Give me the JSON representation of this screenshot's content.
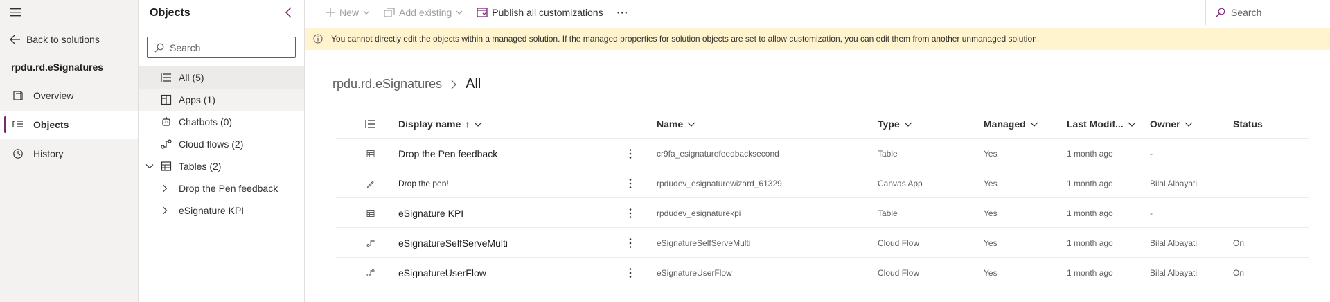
{
  "leftnav": {
    "back_label": "Back to solutions",
    "solution_name": "rpdu.rd.eSignatures",
    "items": [
      {
        "label": "Overview",
        "icon": "overview-icon"
      },
      {
        "label": "Objects",
        "icon": "objects-icon",
        "active": true
      },
      {
        "label": "History",
        "icon": "history-icon"
      }
    ]
  },
  "objects_panel": {
    "title": "Objects",
    "search_placeholder": "Search",
    "tree": [
      {
        "label": "All",
        "count": "(5)"
      },
      {
        "label": "Apps",
        "count": "(1)"
      },
      {
        "label": "Chatbots",
        "count": "(0)"
      },
      {
        "label": "Cloud flows",
        "count": "(2)"
      },
      {
        "label": "Tables",
        "count": "(2)"
      },
      {
        "label": "Drop the Pen feedback"
      },
      {
        "label": "eSignature KPI"
      }
    ]
  },
  "cmdbar": {
    "new_label": "New",
    "add_existing_label": "Add existing",
    "publish_label": "Publish all customizations",
    "more_label": "···",
    "search_label": "Search"
  },
  "warning": {
    "text": "You cannot directly edit the objects within a managed solution. If the managed properties for solution objects are set to allow customization, you can edit them from another unmanaged solution."
  },
  "breadcrumb": {
    "parent": "rpdu.rd.eSignatures",
    "current": "All"
  },
  "grid": {
    "columns": {
      "display_name": "Display name",
      "sort_indicator": "↑",
      "name": "Name",
      "type": "Type",
      "managed": "Managed",
      "modified": "Last Modif...",
      "owner": "Owner",
      "status": "Status"
    },
    "rows": [
      {
        "icon": "table-icon",
        "display_name": "Drop the Pen feedback",
        "name": "cr9fa_esignaturefeedbacksecond",
        "type": "Table",
        "managed": "Yes",
        "modified": "1 month ago",
        "owner": "-",
        "status": ""
      },
      {
        "icon": "pen-icon",
        "display_name": "Drop the pen!",
        "name": "rpdudev_esignaturewizard_61329",
        "type": "Canvas App",
        "managed": "Yes",
        "modified": "1 month ago",
        "owner": "Bilal Albayati",
        "status": ""
      },
      {
        "icon": "table-icon",
        "display_name": "eSignature KPI",
        "name": "rpdudev_esignaturekpi",
        "type": "Table",
        "managed": "Yes",
        "modified": "1 month ago",
        "owner": "-",
        "status": ""
      },
      {
        "icon": "flow-icon",
        "display_name": "eSignatureSelfServeMulti",
        "name": "eSignatureSelfServeMulti",
        "type": "Cloud Flow",
        "managed": "Yes",
        "modified": "1 month ago",
        "owner": "Bilal Albayati",
        "status": "On"
      },
      {
        "icon": "flow-icon",
        "display_name": "eSignatureUserFlow",
        "name": "eSignatureUserFlow",
        "type": "Cloud Flow",
        "managed": "Yes",
        "modified": "1 month ago",
        "owner": "Bilal Albayati",
        "status": "On"
      }
    ]
  },
  "colors": {
    "accent": "#742774",
    "warning_bg": "#fff4ce",
    "nav_bg": "#f3f2f1"
  }
}
